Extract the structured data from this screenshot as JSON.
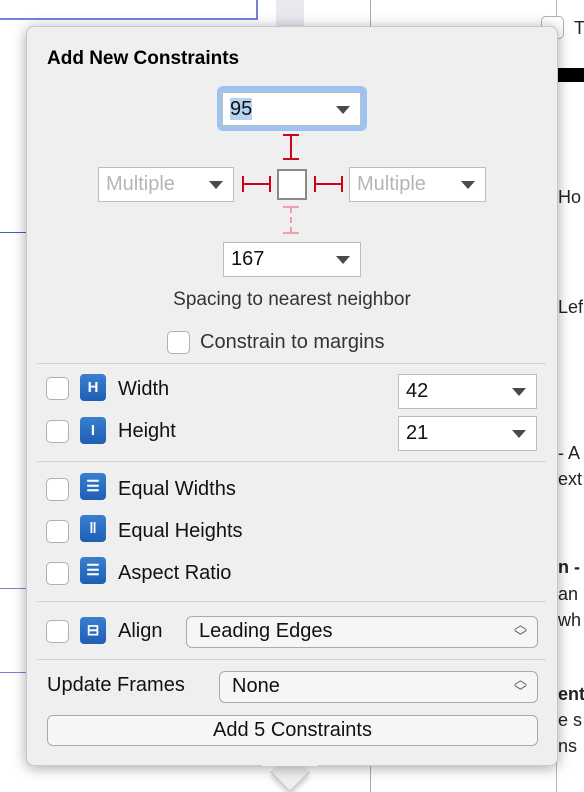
{
  "popover": {
    "title": "Add New Constraints",
    "spacing": {
      "top": "95",
      "left": "Multiple",
      "right": "Multiple",
      "bottom": "167"
    },
    "spacing_caption": "Spacing to nearest neighbor",
    "constrain_to_margins": {
      "label": "Constrain to margins",
      "checked": false
    },
    "size": [
      {
        "label": "Width",
        "value": "42",
        "icon": "width-icon",
        "checked": false
      },
      {
        "label": "Height",
        "value": "21",
        "icon": "height-icon",
        "checked": false
      }
    ],
    "equal": [
      {
        "label": "Equal Widths",
        "icon": "equal-widths-icon",
        "checked": false
      },
      {
        "label": "Equal Heights",
        "icon": "equal-heights-icon",
        "checked": false
      },
      {
        "label": "Aspect Ratio",
        "icon": "aspect-ratio-icon",
        "checked": false
      }
    ],
    "align": {
      "label": "Align",
      "value": "Leading Edges",
      "icon": "align-icon",
      "checked": false
    },
    "update_frames": {
      "label": "Update Frames",
      "value": "None"
    },
    "add_button": "Add 5 Constraints"
  },
  "background_fragments": [
    "T",
    "Ho",
    "Lef",
    "- A",
    "ext",
    "n -",
    "an",
    "wh",
    "ent",
    "e s",
    "ns"
  ],
  "colors": {
    "accent": "#9ec3f0",
    "constraint_red": "#d0021b",
    "icon_blue": "#2a6fc4"
  }
}
